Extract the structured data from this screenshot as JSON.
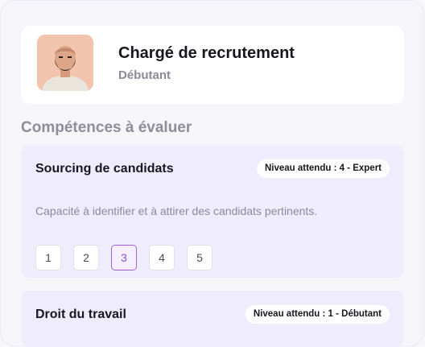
{
  "profile": {
    "title": "Chargé de recrutement",
    "level": "Débutant"
  },
  "section": {
    "title": "Compétences à évaluer"
  },
  "skills": [
    {
      "name": "Sourcing de candidats",
      "badge": "Niveau attendu : 4 - Expert",
      "description": "Capacité à identifier et à attirer des candidats pertinents.",
      "levels": [
        "1",
        "2",
        "3",
        "4",
        "5"
      ],
      "selected_level": "3"
    },
    {
      "name": "Droit du travail",
      "badge": "Niveau attendu : 1 - Débutant"
    }
  ],
  "colors": {
    "accent": "#8d4fd4",
    "card_background": "#efedfd",
    "page_background": "#f6f5fa"
  }
}
